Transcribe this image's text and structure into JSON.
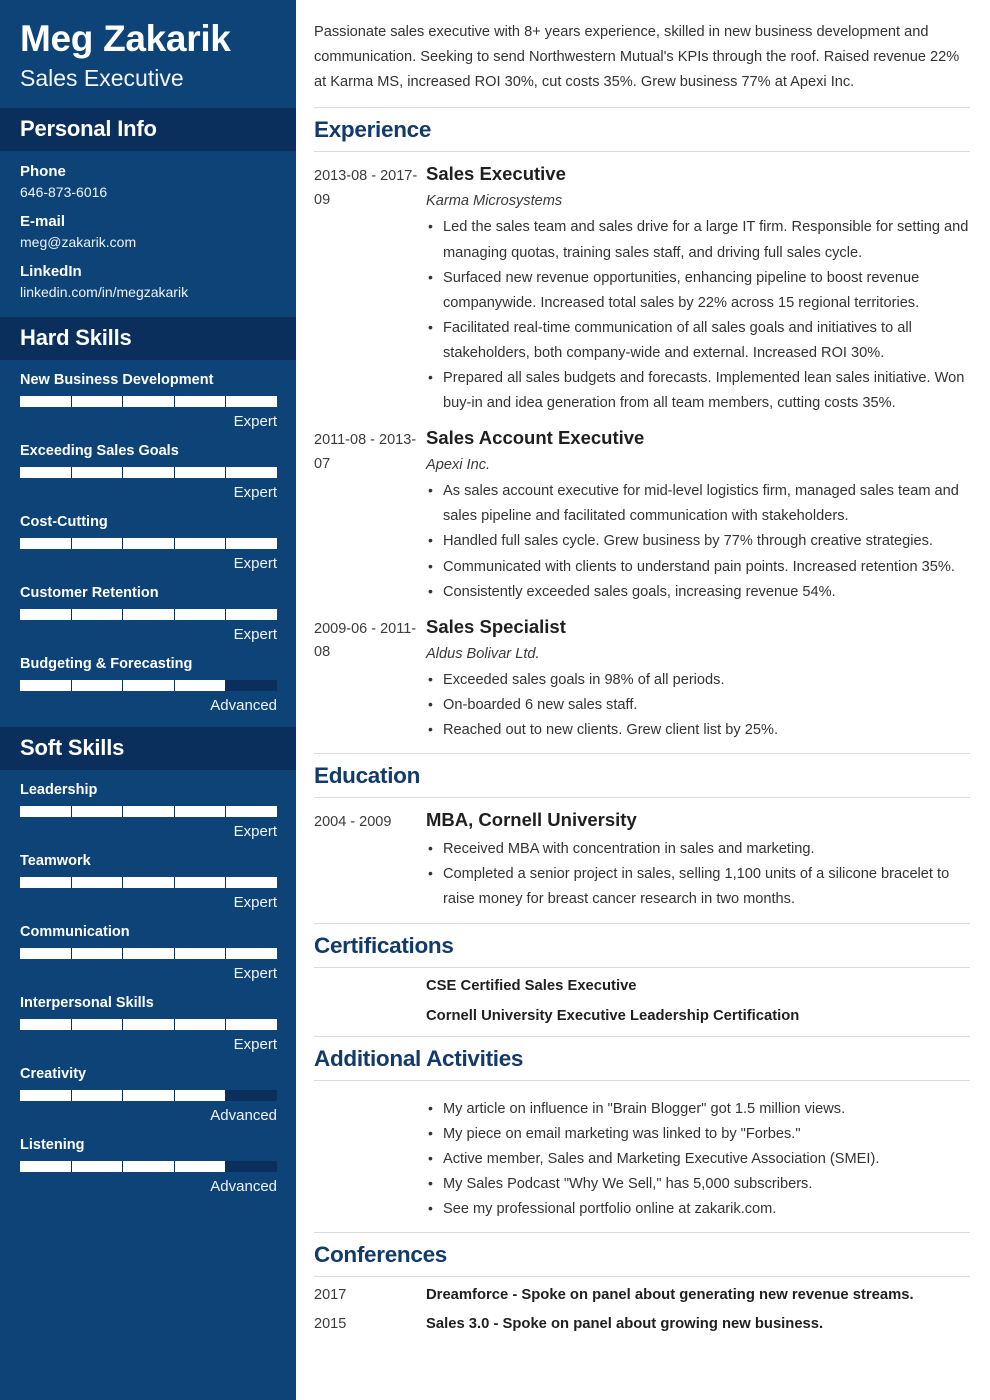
{
  "colors": {
    "sidebar_bg": "#0d4377",
    "sidebar_band_bg": "#0a2f5c",
    "heading_navy": "#123a6b",
    "rule_gray": "#dcdcdc",
    "bar_filled": "#ffffff",
    "bar_empty": "#0a2f5c"
  },
  "sidebar": {
    "full_name": "Meg Zakarik",
    "job_title": "Sales Executive",
    "personal_info": {
      "heading": "Personal Info",
      "items": [
        {
          "label": "Phone",
          "value": "646-873-6016"
        },
        {
          "label": "E-mail",
          "value": "meg@zakarik.com"
        },
        {
          "label": "LinkedIn",
          "value": "linkedin.com/in/megzakarik"
        }
      ]
    },
    "hard_skills": {
      "heading": "Hard Skills",
      "segments": 5,
      "items": [
        {
          "name": "New Business Development",
          "level": "Expert",
          "filled": 5
        },
        {
          "name": "Exceeding Sales Goals",
          "level": "Expert",
          "filled": 5
        },
        {
          "name": "Cost-Cutting",
          "level": "Expert",
          "filled": 5
        },
        {
          "name": "Customer Retention",
          "level": "Expert",
          "filled": 5
        },
        {
          "name": "Budgeting & Forecasting",
          "level": "Advanced",
          "filled": 4
        }
      ]
    },
    "soft_skills": {
      "heading": "Soft Skills",
      "segments": 5,
      "items": [
        {
          "name": "Leadership",
          "level": "Expert",
          "filled": 5
        },
        {
          "name": "Teamwork",
          "level": "Expert",
          "filled": 5
        },
        {
          "name": "Communication",
          "level": "Expert",
          "filled": 5
        },
        {
          "name": "Interpersonal Skills",
          "level": "Expert",
          "filled": 5
        },
        {
          "name": "Creativity",
          "level": "Advanced",
          "filled": 4
        },
        {
          "name": "Listening",
          "level": "Advanced",
          "filled": 4
        }
      ]
    }
  },
  "main": {
    "summary": "Passionate sales executive with 8+ years experience, skilled in new business development and communication. Seeking to send Northwestern Mutual's KPIs through the roof. Raised revenue 22% at Karma MS, increased ROI 30%, cut costs 35%. Grew business 77% at Apexi Inc.",
    "experience": {
      "heading": "Experience",
      "entries": [
        {
          "dates": "2013-08 - 2017-09",
          "title": "Sales Executive",
          "org": "Karma Microsystems",
          "bullets": [
            "Led the sales team and sales drive for a large IT firm. Responsible for setting and managing quotas, training sales staff, and driving full sales cycle.",
            "Surfaced new revenue opportunities, enhancing pipeline to boost revenue companywide. Increased total sales by 22% across 15 regional territories.",
            "Facilitated real-time communication of all sales goals and initiatives to all stakeholders, both company-wide and external. Increased ROI 30%.",
            "Prepared all sales budgets and forecasts. Implemented lean sales initiative. Won buy-in and idea generation from all team members, cutting costs 35%."
          ]
        },
        {
          "dates": "2011-08 - 2013-07",
          "title": "Sales Account Executive",
          "org": "Apexi Inc.",
          "bullets": [
            "As sales account executive for mid-level logistics firm, managed sales team and sales pipeline and facilitated communication with stakeholders.",
            "Handled full sales cycle. Grew business by 77% through creative strategies.",
            "Communicated with clients to understand pain points. Increased retention 35%.",
            "Consistently exceeded sales goals, increasing revenue 54%."
          ]
        },
        {
          "dates": "2009-06 - 2011-08",
          "title": "Sales Specialist",
          "org": "Aldus Bolivar Ltd.",
          "bullets": [
            "Exceeded sales goals in 98% of all periods.",
            "On-boarded 6 new sales staff.",
            "Reached out to new clients. Grew client list by 25%."
          ]
        }
      ]
    },
    "education": {
      "heading": "Education",
      "entries": [
        {
          "dates": "2004 - 2009",
          "title": "MBA, Cornell University",
          "org": "",
          "bullets": [
            "Received MBA with concentration in sales and marketing.",
            "Completed a senior project in sales, selling 1,100 units of a silicone bracelet to raise money for breast cancer research in two months."
          ]
        }
      ]
    },
    "certifications": {
      "heading": "Certifications",
      "items": [
        "CSE Certified Sales Executive",
        "Cornell University Executive Leadership Certification"
      ]
    },
    "additional_activities": {
      "heading": "Additional Activities",
      "items": [
        "My article on influence in \"Brain Blogger\" got 1.5 million views.",
        "My piece on email marketing was linked to by \"Forbes.\"",
        "Active member, Sales and Marketing Executive Association (SMEI).",
        "My Sales Podcast \"Why We Sell,\" has 5,000 subscribers.",
        "See my professional portfolio online at zakarik.com."
      ]
    },
    "conferences": {
      "heading": "Conferences",
      "entries": [
        {
          "year": "2017",
          "text": "Dreamforce - Spoke on panel about generating new revenue streams."
        },
        {
          "year": "2015",
          "text": "Sales 3.0 - Spoke on panel about growing new business."
        }
      ]
    }
  }
}
